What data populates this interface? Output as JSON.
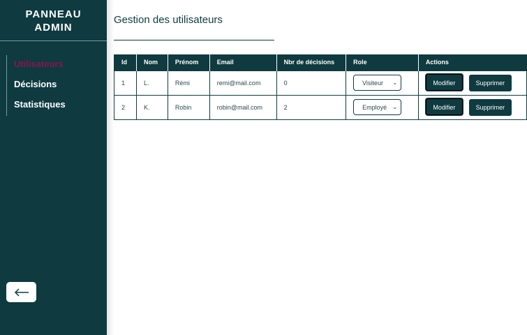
{
  "brand": {
    "line1": "PANNEAU",
    "line2": "ADMIN"
  },
  "nav": {
    "items": [
      {
        "label": "Utilisateurs"
      },
      {
        "label": "Décisions"
      },
      {
        "label": "Statistiques"
      }
    ]
  },
  "back_icon": "arrow-left-icon",
  "page": {
    "title": "Gestion des utilisateurs"
  },
  "table": {
    "headers": [
      "Id",
      "Nom",
      "Prénom",
      "Email",
      "Nbr de décisions",
      "Role",
      "Actions"
    ],
    "rows": [
      {
        "id": "1",
        "nom": "L.",
        "prenom": "Rémi",
        "email": "remi@mail.com",
        "nbr": "0",
        "role": "Visiteur"
      },
      {
        "id": "2",
        "nom": "K.",
        "prenom": "Robin",
        "email": "robin@mail.com",
        "nbr": "2",
        "role": "Employé"
      }
    ],
    "modify_label": "Modifier",
    "delete_label": "Supprimer"
  },
  "colors": {
    "primary": "#0e3a40",
    "active_nav": "#8a1548",
    "background": "#ffffff"
  }
}
